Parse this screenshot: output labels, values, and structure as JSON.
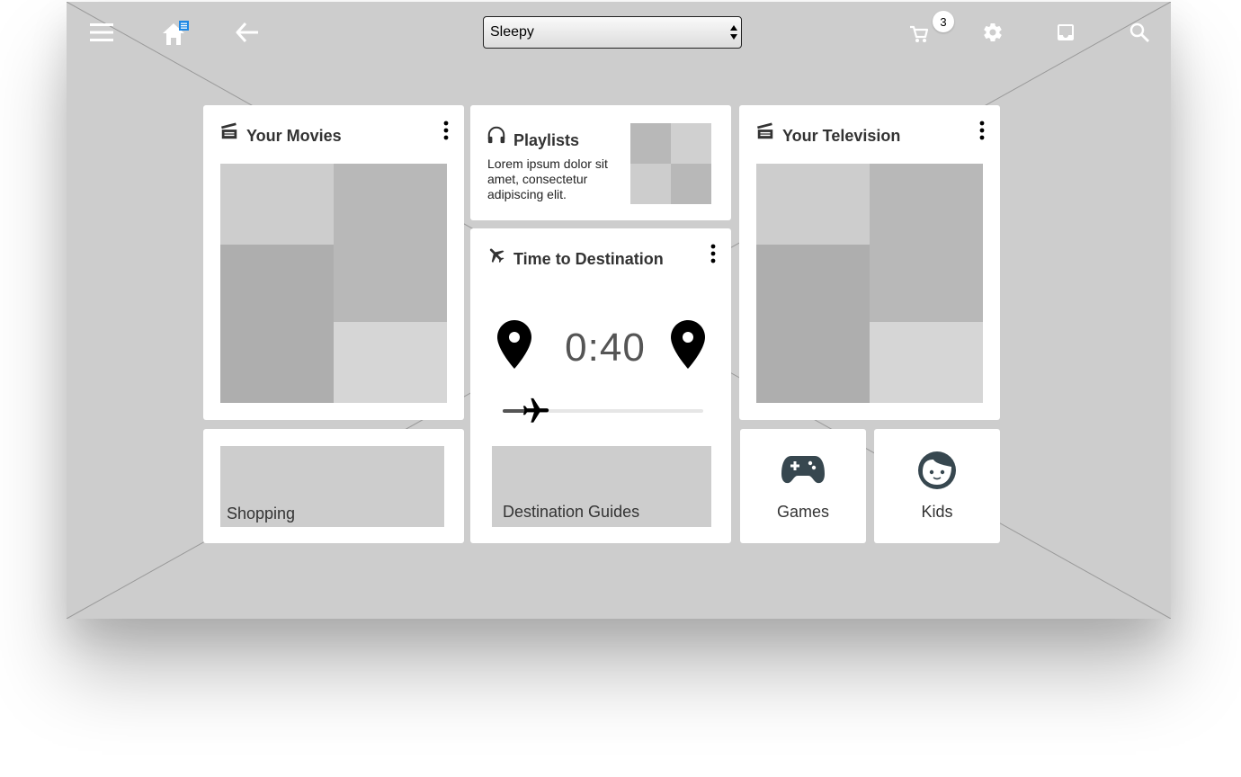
{
  "topbar": {
    "icons": [
      "menu-icon",
      "home-icon",
      "back-icon",
      "cart-icon",
      "gear-icon",
      "inbox-icon",
      "search-icon"
    ],
    "mode_select": {
      "value": "Sleepy"
    },
    "cart_count": "3"
  },
  "cards": {
    "movies": {
      "title": "Your Movies",
      "icon": "film-icon"
    },
    "playlists": {
      "title": "Playlists",
      "icon": "headphones-icon",
      "description": "Lorem ipsum dolor sit amet, consectetur adipiscing elit."
    },
    "television": {
      "title": "Your Television",
      "icon": "film-icon"
    },
    "destination": {
      "title": "Time to Destination",
      "icon": "airplane-icon",
      "time": "0:40",
      "progress": 0.12
    },
    "shopping": {
      "label": "Shopping"
    },
    "guides": {
      "label": "Destination Guides"
    },
    "games": {
      "label": "Games",
      "icon": "gamepad-icon"
    },
    "kids": {
      "label": "Kids",
      "icon": "kid-face-icon"
    }
  },
  "colors": {
    "background": "#cdcdcd",
    "card": "#ffffff",
    "icon_dark": "#37474f",
    "badge_blue": "#2196f3"
  }
}
